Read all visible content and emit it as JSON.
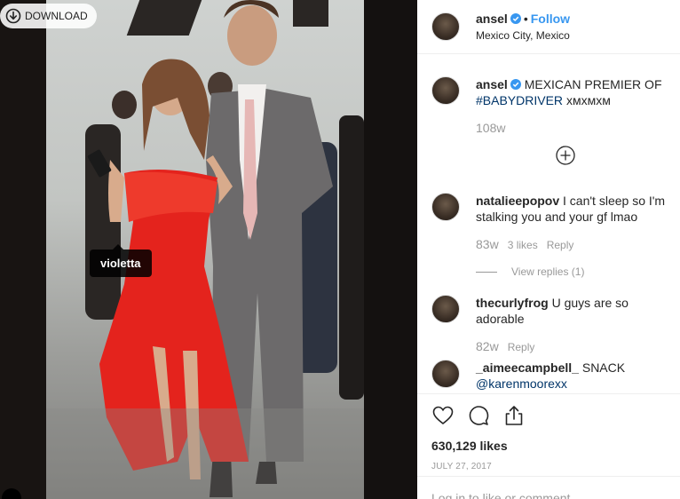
{
  "photo": {
    "download_label": "DOWNLOAD",
    "tag_label": "violetta"
  },
  "post": {
    "username": "ansel",
    "follow_label": "Follow",
    "location": "Mexico City, Mexico",
    "caption_text": "MEXICAN PREMIER OF",
    "caption_hashtag": "#BABYDRIVER",
    "caption_tail": "хмхмхм",
    "caption_age": "108w",
    "likes": "630,129 likes",
    "date": "JULY 27, 2017",
    "add_comment_placeholder": "Log in to like or comment."
  },
  "comments": [
    {
      "username": "natalieepopov",
      "text": "I can't sleep so I'm stalking you and your gf lmao",
      "age": "83w",
      "likes": "3 likes",
      "reply": "Reply",
      "view_replies": "View replies (1)"
    },
    {
      "username": "thecurlyfrog",
      "text": "U guys are so adorable",
      "age": "82w",
      "reply": "Reply"
    },
    {
      "username": "_aimeecampbell_",
      "text": "SNACK",
      "mention": "@karenmoorexx"
    }
  ],
  "icons": [
    "download-icon",
    "verified-badge-icon",
    "add-circle-icon",
    "heart-icon",
    "comment-icon",
    "share-icon"
  ],
  "colors": {
    "link": "#3897f0",
    "hashtag": "#003569",
    "muted": "#999999"
  }
}
